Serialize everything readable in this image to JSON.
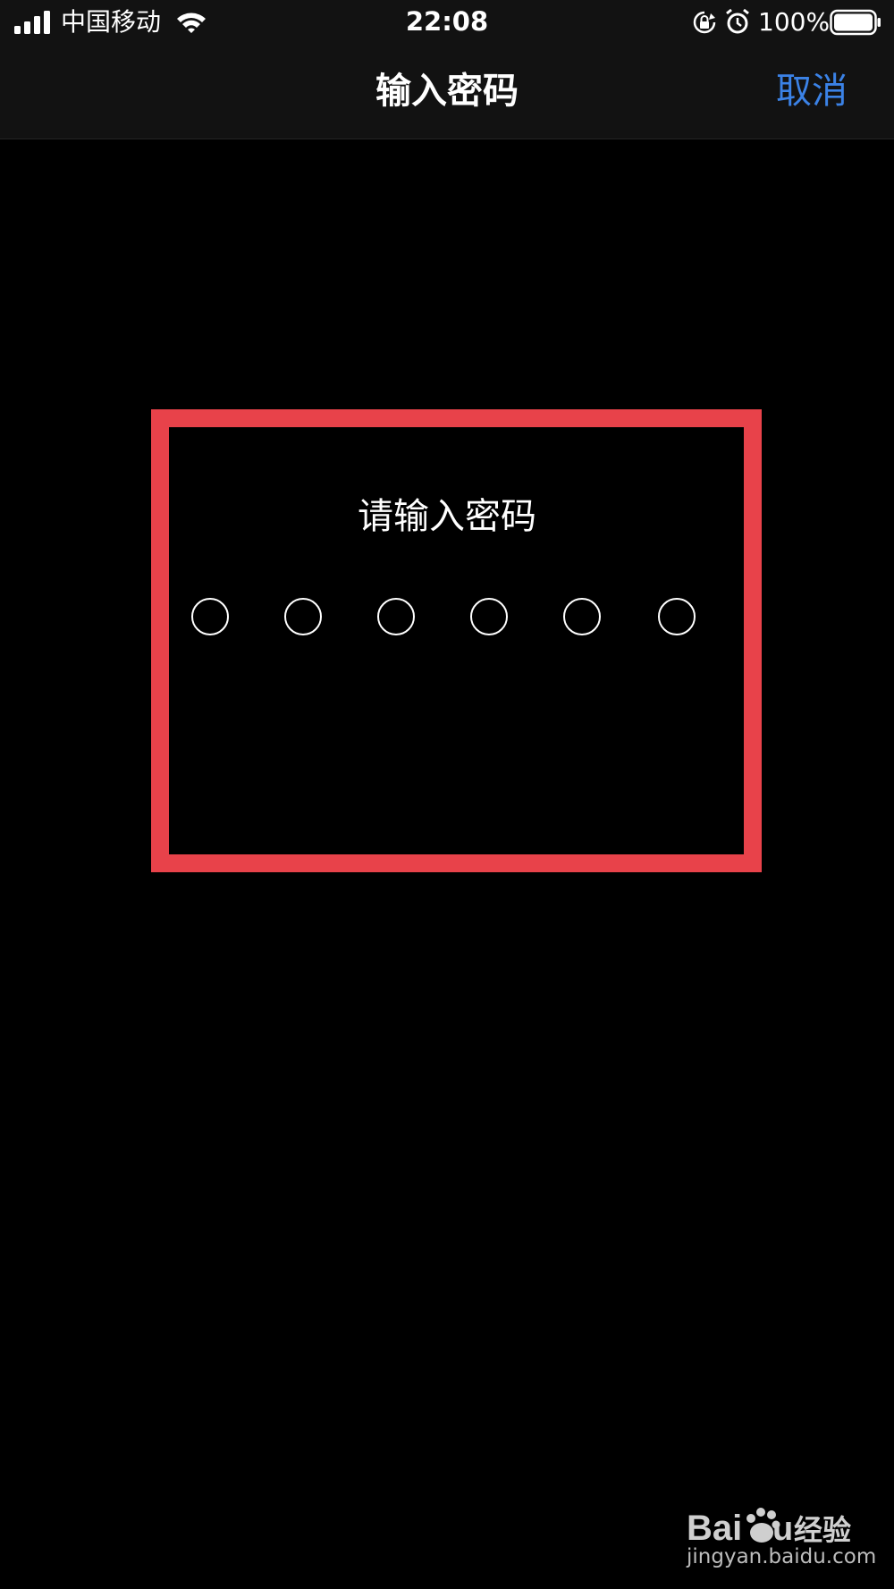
{
  "status_bar": {
    "carrier": "中国移动",
    "time": "22:08",
    "battery": "100%",
    "icons": [
      "signal-icon",
      "wifi-icon",
      "orientation-lock-icon",
      "alarm-icon",
      "battery-icon"
    ]
  },
  "nav": {
    "title": "输入密码",
    "cancel_label": "取消"
  },
  "passcode": {
    "prompt": "请输入密码",
    "digit_count": 6,
    "entered_count": 0
  },
  "colors": {
    "accent": "#3b82e6",
    "highlight": "#e8424a",
    "background": "#000000"
  },
  "watermark": {
    "text": "jingyan.baidu.com",
    "logo_text": "Baidu 经验"
  }
}
